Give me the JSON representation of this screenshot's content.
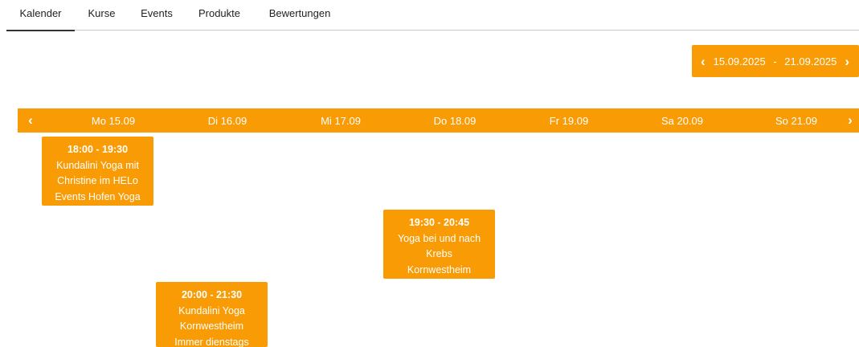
{
  "tabs": [
    {
      "label": "Kalender",
      "active": true
    },
    {
      "label": "Kurse",
      "active": false
    },
    {
      "label": "Events",
      "active": false
    },
    {
      "label": "Produkte",
      "active": false
    },
    {
      "label": "Bewertungen",
      "active": false
    }
  ],
  "range": {
    "prev_icon": "chevron-left-icon",
    "start": "15.09.2025",
    "separator": "-",
    "end": "21.09.2025",
    "next_icon": "chevron-right-icon"
  },
  "week": {
    "prev_glyph": "‹",
    "next_glyph": "›",
    "days": [
      "Mo 15.09",
      "Di 16.09",
      "Mi 17.09",
      "Do 18.09",
      "Fr 19.09",
      "Sa 20.09",
      "So 21.09"
    ]
  },
  "events": [
    {
      "time": "18:00 - 19:30",
      "lines": [
        "Kundalini Yoga mit",
        "Christine im HELo",
        "Events Hofen Yoga"
      ]
    },
    {
      "time": "19:30 - 20:45",
      "lines": [
        "Yoga bei und nach",
        "Krebs",
        "Kornwestheim"
      ]
    },
    {
      "time": "20:00 - 21:30",
      "lines": [
        "Kundalini Yoga",
        "Kornwestheim",
        "Immer dienstags"
      ]
    }
  ],
  "colors": {
    "accent": "#f99b05",
    "text_on_accent": "#ffffff"
  }
}
